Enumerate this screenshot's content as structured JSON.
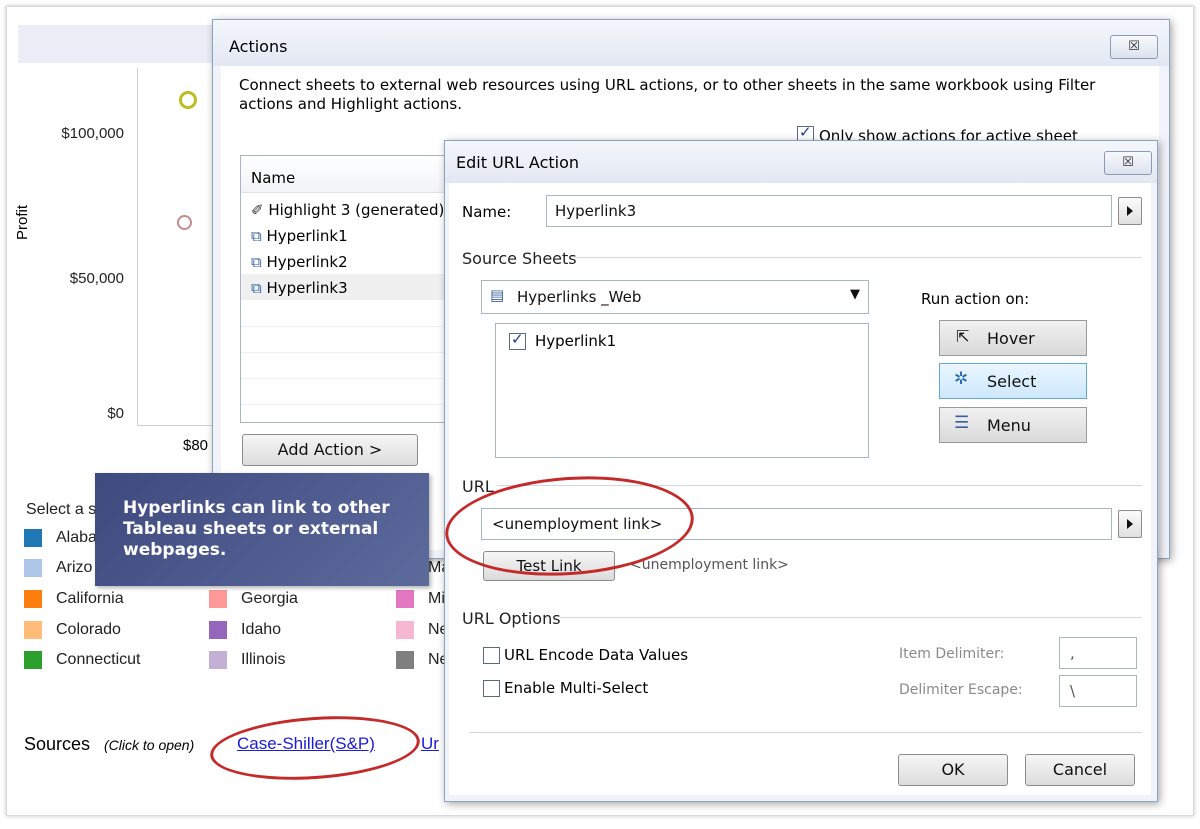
{
  "background": {
    "axis": {
      "ylabel": "Profit",
      "ticks": [
        "$100,000",
        "$50,000",
        "$0"
      ],
      "xtick_partial": "$80"
    },
    "legend_title_partial": "Select a s",
    "legend_cols": [
      [
        "Alaba",
        "Arizo",
        "California",
        "Colorado",
        "Connecticut"
      ],
      [
        "Georgia",
        "Idaho",
        "Illinois"
      ],
      [
        "Ma",
        "Mi",
        "Ne",
        "Ne"
      ]
    ],
    "legend_colors": {
      "col1": [
        "#1f77b4",
        "#aec7e8",
        "#ff7f0e",
        "#ffbb78",
        "#2ca02c"
      ],
      "col2": [
        "#ff9896",
        "#9467bd",
        "#c5b0d5"
      ],
      "col3": [
        "#e377c2",
        "#f7b6d2",
        "#7f7f7f"
      ]
    },
    "sources_label": "Sources",
    "sources_hint": "(Click to open)",
    "sources_link": "Case-Shiller(S&P)",
    "sources_link2_partial": "Ur"
  },
  "callout": {
    "text": "Hyperlinks can link to other Tableau sheets or external webpages."
  },
  "actions_dialog": {
    "title": "Actions",
    "close": "☒",
    "description": "Connect sheets to external web resources using URL actions, or to other sheets in the same workbook using Filter actions and Highlight actions.",
    "only_show_label": "Only show actions for active sheet",
    "list_header": "Name",
    "items": [
      "Highlight 3 (generated)",
      "Hyperlink1",
      "Hyperlink2",
      "Hyperlink3"
    ],
    "add_action_label": "Add Action >"
  },
  "edit_dialog": {
    "title": "Edit URL Action",
    "close": "☒",
    "name_label": "Name:",
    "name_value": "Hyperlink3",
    "source_sheets_label": "Source Sheets",
    "sheet_dropdown_value": "Hyperlinks _Web",
    "sheets": [
      {
        "label": "Hyperlink1",
        "checked": true
      }
    ],
    "run_action_label": "Run action on:",
    "run_options": [
      "Hover",
      "Select",
      "Menu"
    ],
    "run_selected": "Select",
    "url_label": "URL",
    "url_value": "<unemployment link>",
    "test_link_label": "Test Link",
    "url_preview": "<unemployment link>",
    "url_options_label": "URL Options",
    "encode_label": "URL Encode Data Values",
    "multi_select_label": "Enable Multi-Select",
    "item_delimiter_label": "Item Delimiter:",
    "item_delimiter_value": ",",
    "delimiter_escape_label": "Delimiter Escape:",
    "delimiter_escape_value": "\\",
    "ok_label": "OK",
    "cancel_label": "Cancel"
  },
  "colors": {
    "callout_bg": "#4d5a8c",
    "link": "#1a1ad8",
    "highlight_ellipse": "#c42a2a",
    "selected_button": "#cde8fb"
  }
}
